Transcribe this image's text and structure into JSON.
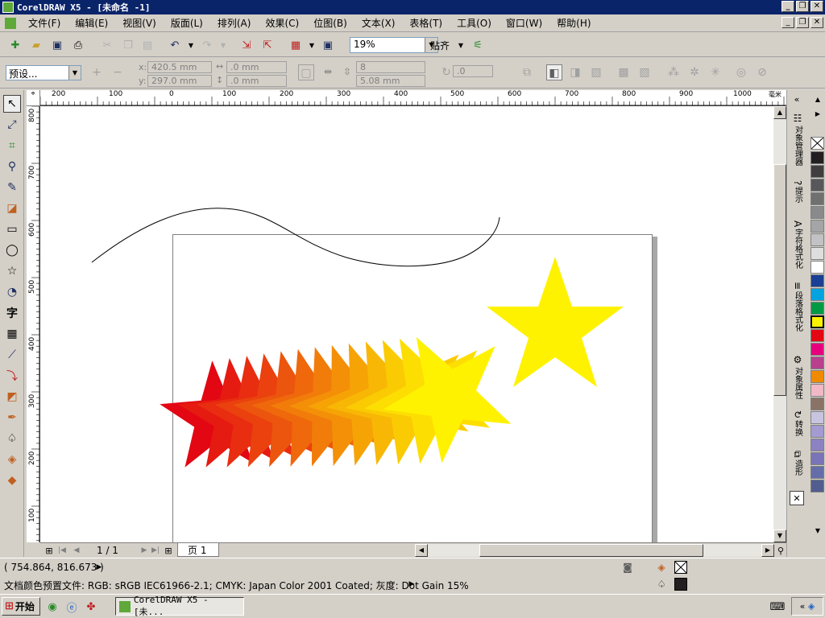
{
  "window": {
    "title": "CorelDRAW X5 - [未命名 -1]",
    "buttons": [
      "_",
      "❐",
      "✕"
    ]
  },
  "menu": [
    "文件(F)",
    "编辑(E)",
    "视图(V)",
    "版面(L)",
    "排列(A)",
    "效果(C)",
    "位图(B)",
    "文本(X)",
    "表格(T)",
    "工具(O)",
    "窗口(W)",
    "帮助(H)"
  ],
  "toolbar": {
    "zoom_value": "19%",
    "snap_label": "贴齐"
  },
  "propbar": {
    "preset": "预设...",
    "x_label": "x:",
    "x_value": "420.5 mm",
    "y_label": "y:",
    "y_value": "297.0 mm",
    "w_value": ".0 mm",
    "h_value": ".0 mm",
    "count_value": "8",
    "sharp_value": "5.08 mm",
    "angle_value": ".0"
  },
  "rulers": {
    "h_ticks": [
      "200",
      "100",
      "0",
      "100",
      "200",
      "300",
      "400",
      "500",
      "600",
      "700",
      "800",
      "900",
      "1000"
    ],
    "h_unit": "毫米",
    "v_ticks": [
      "800",
      "700",
      "600",
      "500",
      "400",
      "300",
      "200",
      "100"
    ]
  },
  "bottom_nav": {
    "page_count": "1 / 1",
    "page_tab": "页 1"
  },
  "dockers": [
    "对象管理器",
    "提示",
    "字符格式化",
    "段落格式化",
    "对象属性",
    "转换",
    "造形"
  ],
  "palette_colors": [
    "#231f20",
    "#403d3e",
    "#58585a",
    "#707071",
    "#8a8a8c",
    "#a5a5a7",
    "#c2c2c4",
    "#dededf",
    "#ffffff",
    "#1b3f94",
    "#00a3e0",
    "#009a44",
    "#fff200",
    "#e30613",
    "#e6007e",
    "#b8408d",
    "#f08a00",
    "#f2b8c6",
    "#8a7366",
    "#c8c4e0",
    "#a39bd1",
    "#8c82c2",
    "#7a74b8",
    "#656ea8",
    "#525d8f"
  ],
  "status": {
    "coords": "( 754.864, 816.673 )",
    "color_profile": "文档颜色预置文件: RGB: sRGB IEC61966-2.1; CMYK: Japan Color 2001 Coated; 灰度: Dot Gain 15%"
  },
  "taskbar": {
    "start": "开始",
    "task": "CorelDRAW X5 - [未..."
  },
  "colors": {
    "title_bg": "#0a246a",
    "star_red": "#e30613",
    "star_yellow": "#fff200"
  }
}
